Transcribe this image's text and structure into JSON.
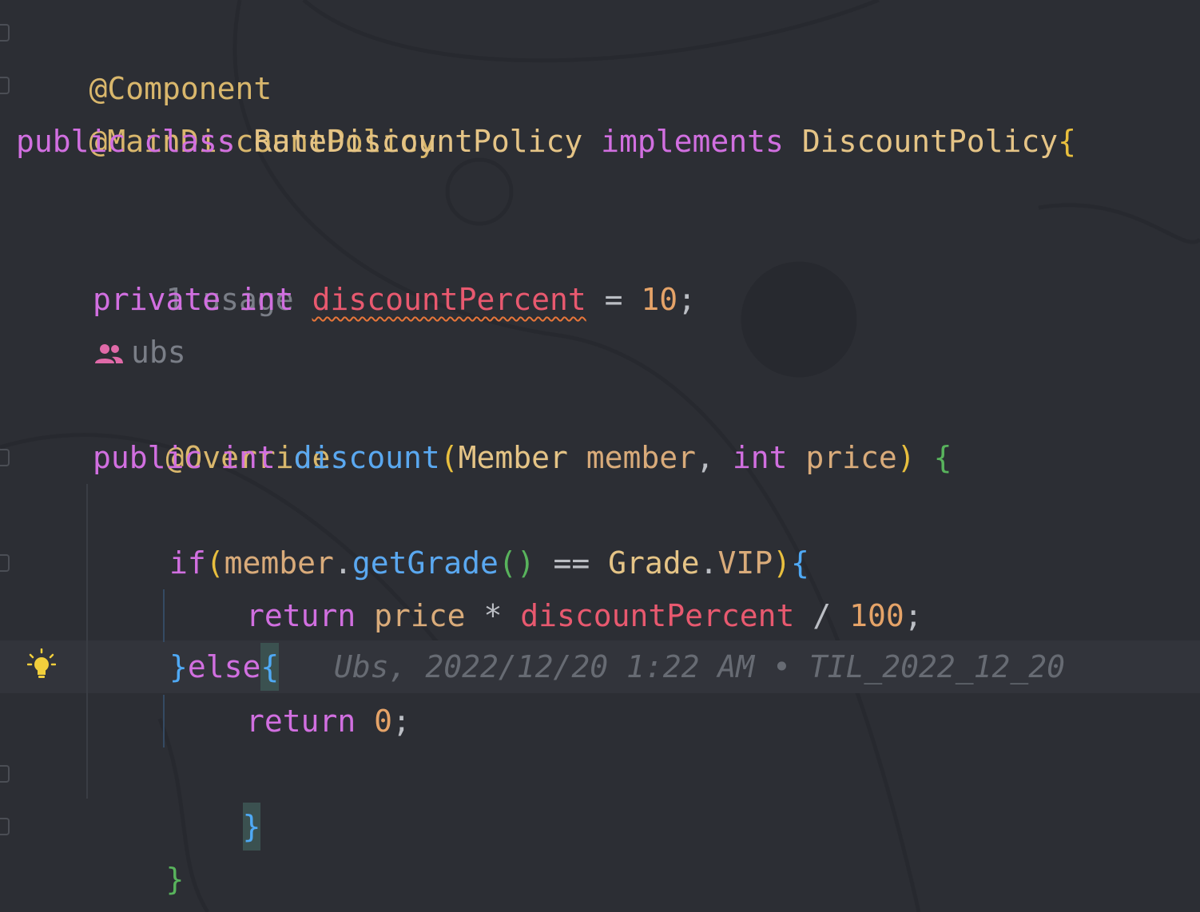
{
  "code": {
    "line1": {
      "annotation": "@Component"
    },
    "line2": {
      "annotation": "@MainDiscountPolicy"
    },
    "line3": {
      "kw_public": "public",
      "kw_class": "class",
      "class_name": "RateDiscountPolicy",
      "kw_implements": "implements",
      "iface": "DiscountPolicy",
      "brace": "{"
    },
    "usage_hint": "1 usage",
    "line_field": {
      "kw_private": "private",
      "kw_int": "int",
      "field": "discountPercent",
      "eq": "=",
      "value": "10",
      "semi": ";"
    },
    "author_hint": "ubs",
    "override": "@Override",
    "line_method": {
      "kw_public": "public",
      "kw_int": "int",
      "method": "discount",
      "lparen": "(",
      "type": "Member",
      "param1": "member",
      "comma": ",",
      "kw_int2": "int",
      "param2": "price",
      "rparen": ")",
      "brace": "{"
    },
    "line_if": {
      "kw_if": "if",
      "lparen": "(",
      "obj": "member",
      "dot": ".",
      "call": "getGrade",
      "call_parens": "()",
      "op": "==",
      "enum_type": "Grade",
      "dot2": ".",
      "enum_val": "VIP",
      "rparen": ")",
      "brace": "{"
    },
    "line_return1": {
      "kw_return": "return",
      "var": "price",
      "op": "*",
      "field": "discountPercent",
      "div": "/",
      "num": "100",
      "semi": ";"
    },
    "line_else": {
      "close": "}",
      "kw_else": "else",
      "brace": "{",
      "blame": "Ubs, 2022/12/20 1:22 AM • TIL_2022_12_20"
    },
    "line_return2": {
      "kw_return": "return",
      "num": "0",
      "semi": ";"
    },
    "close_if": "}",
    "close_method": "}",
    "close_class": "}"
  },
  "colors": {
    "background": "#2c2e34",
    "keyword": "#d16fe0",
    "annotation": "#d9b76c",
    "field": "#e8596f",
    "number": "#e5a368",
    "method": "#5aa8f0"
  },
  "icons": {
    "gutter": "lightbulb-icon",
    "author": "users-icon"
  }
}
